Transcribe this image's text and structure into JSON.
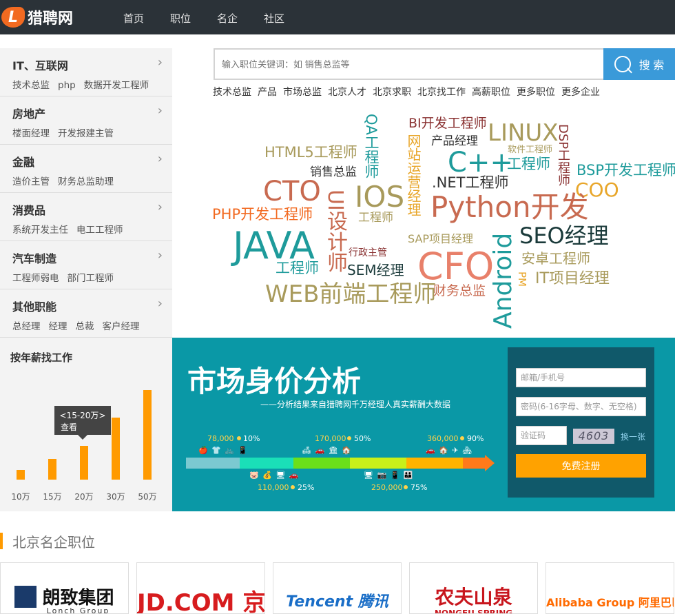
{
  "app": {
    "logo_mark": "L",
    "logo_text": "猎聘网"
  },
  "nav": [
    "首页",
    "职位",
    "名企",
    "社区"
  ],
  "categories": [
    {
      "title": "IT、互联网",
      "subs": [
        "技术总监",
        "php",
        "数据开发工程师"
      ]
    },
    {
      "title": "房地产",
      "subs": [
        "楼面经理",
        "开发报建主管"
      ]
    },
    {
      "title": "金融",
      "subs": [
        "造价主管",
        "财务总监助理"
      ]
    },
    {
      "title": "消费品",
      "subs": [
        "系统开发主任",
        "电工工程师"
      ]
    },
    {
      "title": "汽车制造",
      "subs": [
        "工程师弱电",
        "部门工程师"
      ]
    },
    {
      "title": "其他职能",
      "subs": [
        "总经理",
        "经理",
        "总裁",
        "客户经理"
      ]
    }
  ],
  "search": {
    "placeholder": "输入职位关键词：如 销售总监等",
    "button": "搜 索"
  },
  "hotlinks": [
    "技术总监",
    "产品",
    "市场总监",
    "北京人才",
    "北京求职",
    "北京找工作",
    "高薪职位",
    "更多职位",
    "更多企业"
  ],
  "tags": [
    "QA工程师",
    "BI开发工程师",
    "LINUX",
    "DSP工程师",
    "网站运营经理",
    "产品经理",
    "软件工程师",
    "HTML5工程师",
    "C++",
    "工程师",
    "BSP开发工程师",
    "销售总监",
    ".NET工程师",
    "CTO",
    "IOS",
    "COO",
    "UI设计师",
    "Python开发",
    "PHP开发工程师",
    "工程师",
    "JAVA",
    "SAP项目经理",
    "SEO经理",
    "Android",
    "行政主管",
    "CFO",
    "安卓工程师",
    "工程师",
    "SEM经理",
    "PM",
    "IT项目经理",
    "WEB前端工程师",
    "财务总监"
  ],
  "salary": {
    "title": "按年薪找工作",
    "tooltip_range": "<15-20万>",
    "tooltip_link": "查看",
    "bars": [
      {
        "label": "10万",
        "value": 0.11
      },
      {
        "label": "15万",
        "value": 0.23
      },
      {
        "label": "20万",
        "value": 0.38
      },
      {
        "label": "30万",
        "value": 0.69
      },
      {
        "label": "50万",
        "value": 1.0
      }
    ]
  },
  "market": {
    "title": "市场身价分析",
    "subtitle": "——分析结果来自猎聘网千万经理人真实薪酬大数据",
    "points": [
      {
        "value": "78,000",
        "pct": "10%"
      },
      {
        "value": "110,000",
        "pct": "25%"
      },
      {
        "value": "170,000",
        "pct": "50%"
      },
      {
        "value": "250,000",
        "pct": "75%"
      },
      {
        "value": "360,000",
        "pct": "90%"
      }
    ],
    "icons": [
      "🍎 👕 🚲 📱",
      "🐷 💰 🖥 🚗",
      "🛋 🚗 🏛 🏠",
      "🖥 📷 📱 👪",
      "🚗 🏠 ✈ 🏘"
    ]
  },
  "register": {
    "email_placeholder": "邮箱/手机号",
    "password_placeholder": "密码(6-16字母、数字、无空格)",
    "captcha_placeholder": "验证码",
    "captcha_text": "4603",
    "swap": "换一张",
    "submit": "免费注册"
  },
  "companies_title": "北京名企职位",
  "companies": [
    "朗致集团",
    "JD.COM 京东",
    "Tencent 腾讯",
    "农夫山泉",
    "Alibaba Group 阿里巴巴集团"
  ],
  "companies_sub": [
    "Lonch Group",
    "",
    "",
    "NONGFU SPRING",
    ""
  ]
}
